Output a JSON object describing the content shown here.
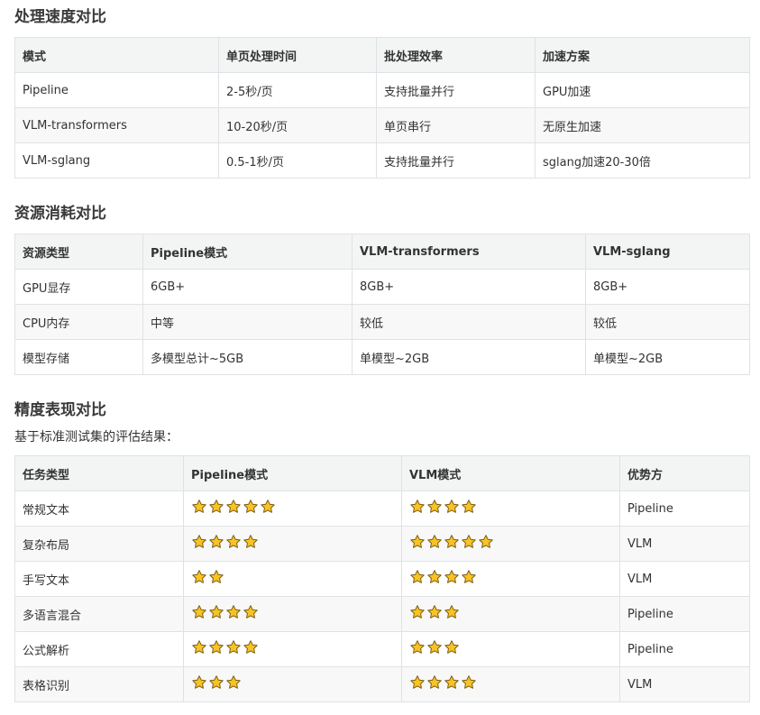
{
  "sections": {
    "speed": {
      "title": "处理速度对比",
      "headers": [
        "模式",
        "单页处理时间",
        "批处理效率",
        "加速方案"
      ],
      "rows": [
        [
          "Pipeline",
          "2-5秒/页",
          "支持批量并行",
          "GPU加速"
        ],
        [
          "VLM-transformers",
          "10-20秒/页",
          "单页串行",
          "无原生加速"
        ],
        [
          "VLM-sglang",
          "0.5-1秒/页",
          "支持批量并行",
          "sglang加速20-30倍"
        ]
      ]
    },
    "resource": {
      "title": "资源消耗对比",
      "headers": [
        "资源类型",
        "Pipeline模式",
        "VLM-transformers",
        "VLM-sglang"
      ],
      "rows": [
        [
          "GPU显存",
          "6GB+",
          "8GB+",
          "8GB+"
        ],
        [
          "CPU内存",
          "中等",
          "较低",
          "较低"
        ],
        [
          "模型存储",
          "多模型总计~5GB",
          "单模型~2GB",
          "单模型~2GB"
        ]
      ]
    },
    "accuracy": {
      "title": "精度表现对比",
      "intro": "基于标准测试集的评估结果：",
      "headers": [
        "任务类型",
        "Pipeline模式",
        "VLM模式",
        "优势方"
      ],
      "rows": [
        {
          "task": "常规文本",
          "pipeline_stars": 5,
          "vlm_stars": 4,
          "winner": "Pipeline"
        },
        {
          "task": "复杂布局",
          "pipeline_stars": 4,
          "vlm_stars": 5,
          "winner": "VLM"
        },
        {
          "task": "手写文本",
          "pipeline_stars": 2,
          "vlm_stars": 4,
          "winner": "VLM"
        },
        {
          "task": "多语言混合",
          "pipeline_stars": 4,
          "vlm_stars": 3,
          "winner": "Pipeline"
        },
        {
          "task": "公式解析",
          "pipeline_stars": 4,
          "vlm_stars": 3,
          "winner": "Pipeline"
        },
        {
          "task": "表格识别",
          "pipeline_stars": 3,
          "vlm_stars": 4,
          "winner": "VLM"
        }
      ],
      "star_icon": "star-icon",
      "star_fill": "#f7c325",
      "star_stroke": "#7a5a12"
    }
  }
}
